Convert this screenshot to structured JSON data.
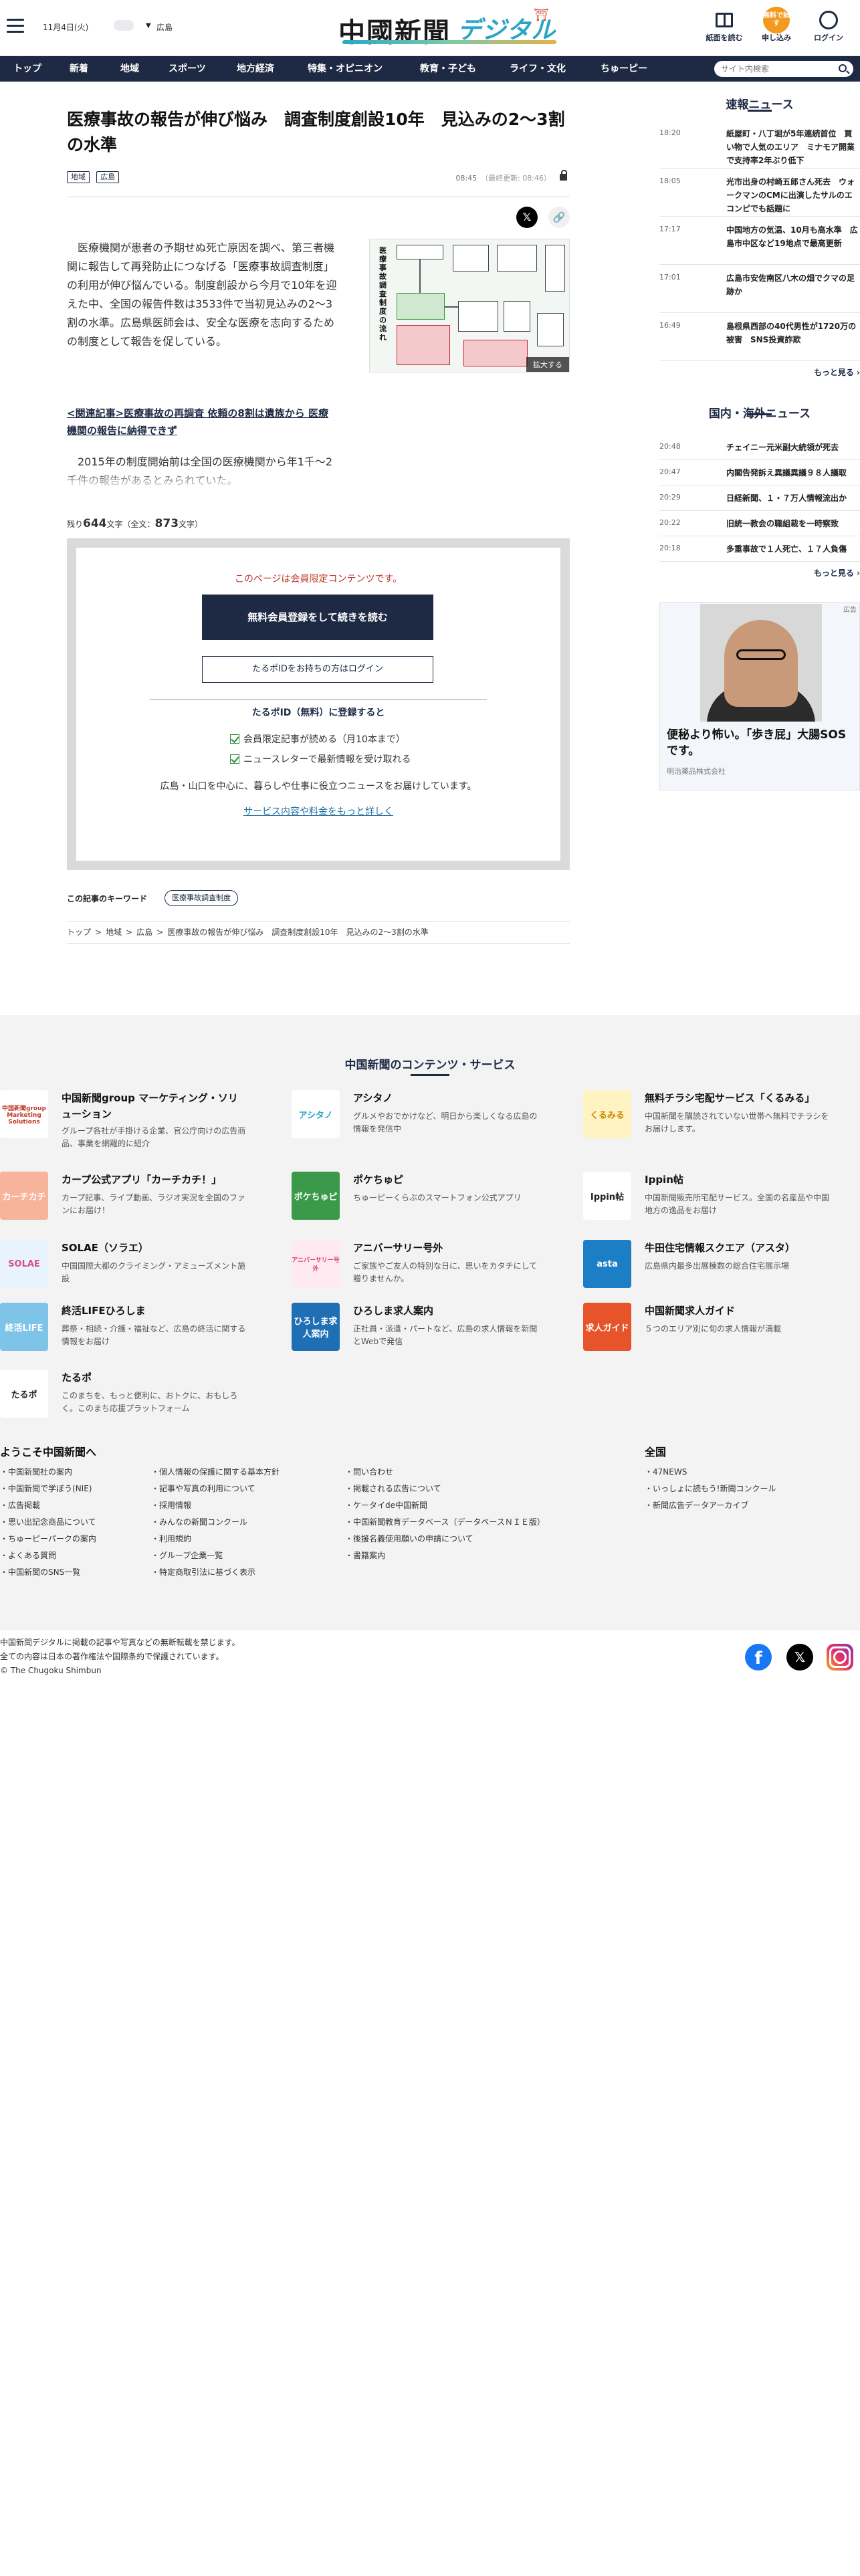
{
  "header": {
    "date": "11月4日(火)",
    "region": "広島",
    "region_arrow": "▼",
    "logo_main": "中國新聞",
    "logo_sub": "デジタル",
    "actions": [
      {
        "label": "紙面を読む",
        "icon": "newspaper-icon"
      },
      {
        "label": "申し込み",
        "icon": "trial-badge-icon",
        "badge": "無料で試す"
      },
      {
        "label": "ログイン",
        "icon": "login-icon"
      }
    ]
  },
  "nav": {
    "items": [
      "トップ",
      "新着",
      "地域",
      "スポーツ",
      "地方経済",
      "特集・オピニオン",
      "教育・子ども",
      "ライフ・文化",
      "ちゅーピー"
    ],
    "search_placeholder": "サイト内検索"
  },
  "article": {
    "title": "医療事故の報告が伸び悩み　調査制度創設10年　見込みの2～3割の水準",
    "tags": [
      "地域",
      "広島"
    ],
    "published": "08:45",
    "updated": "（最終更新: 08:46）",
    "lead": "医療機関が患者の予期せぬ死亡原因を調べ、第三者機関に報告して再発防止につなげる「医療事故調査制度」の利用が伸び悩んでいる。制度創設から今月で10年を迎えた中、全国の報告件数は3533件で当初見込みの2～3割の水準。広島県医師会は、安全な医療を志向するための制度として報告を促している。",
    "figure_title": "医療事故調査制度の流れ",
    "figure_enlarge": "拡大する",
    "related_link": "<関連記事>医療事故の再調査 依頼の8割は遺族から 医療機関の報告に納得できず",
    "para2": "2015年の制度開始前は全国の医療機関から年1千～2千件の報告があるとみられていた。",
    "remaining_prefix": "残り",
    "remaining_count": "644",
    "remaining_mid": "文字（全文：",
    "total_count": "873",
    "remaining_suffix": "文字）"
  },
  "paywall": {
    "note": "このページは会員限定コンテンツです。",
    "register_button": "無料会員登録をして続きを読む",
    "login_button": "たるポIDをお持ちの方はログイン",
    "free_heading": "たるポID（無料）に登録すると",
    "benefits": [
      "会員限定記事が読める（月10本まで）",
      "ニュースレターで最新情報を受け取れる"
    ],
    "region_text": "広島・山口を中心に、暮らしや仕事に役立つニュースをお届けしています。",
    "more_link": "サービス内容や料金をもっと詳しく"
  },
  "keywords": {
    "label": "この記事のキーワード",
    "items": [
      "医療事故調査制度"
    ]
  },
  "breadcrumb": [
    "トップ",
    ">",
    "地域",
    ">",
    "広島",
    ">",
    "医療事故の報告が伸び悩み　調査制度創設10年　見込みの2～3割の水準"
  ],
  "sidebar": {
    "breaking_head": "速報ニュース",
    "breaking": [
      {
        "time": "18:20",
        "text": "紙屋町・八丁堀が5年連続首位　買い物で人気のエリア　ミナモア開業で支持率2年ぶり低下"
      },
      {
        "time": "18:05",
        "text": "光市出身の村崎五郎さん死去　ウォークマンのCMに出演したサルのエコンピでも話題に"
      },
      {
        "time": "17:17",
        "text": "中国地方の気温、10月も高水準　広島市中区など19地点で最高更新"
      },
      {
        "time": "17:01",
        "text": "広島市安佐南区八木の畑でクマの足跡か"
      },
      {
        "time": "16:49",
        "text": "島根県西部の40代男性が1720万の被害　SNS投資詐欺"
      }
    ],
    "more": "もっと見る",
    "world_head": "国内・海外ニュース",
    "world": [
      {
        "time": "20:48",
        "text": "チェイニー元米副大統領が死去"
      },
      {
        "time": "20:47",
        "text": "内閣告発訴え異議異議９８人議取"
      },
      {
        "time": "20:29",
        "text": "日経新聞、１・７万人情報流出か"
      },
      {
        "time": "20:22",
        "text": "旧統一教会の職組裁を一時察致"
      },
      {
        "time": "20:18",
        "text": "多重事故で１人死亡、１７人負傷"
      }
    ],
    "ad_tag": "広告",
    "ad_title": "便秘より怖い。「歩き屁」大腸SOSです。",
    "ad_sponsor": "明治薬品株式会社"
  },
  "services": {
    "heading": "中国新聞のコンテンツ・サービス",
    "items": [
      {
        "title": "中国新聞group マーケティング・ソリューション",
        "desc": "グループ各社が手掛ける企業、官公庁向けの広告商品、事業を網羅的に紹介",
        "icon_text": "中国新聞group Marketing Solutions",
        "color": "#ffffff",
        "fg": "#c0392b"
      },
      {
        "title": "アシタノ",
        "desc": "グルメやおでかけなど、明日から楽しくなる広島の情報を発信中",
        "icon_text": "アシタノ",
        "color": "#ffffff",
        "fg": "#2aa6c4"
      },
      {
        "title": "無料チラシ宅配サービス「くるみる」",
        "desc": "中国新聞を購読されていない世帯へ無料でチラシをお届けします。",
        "icon_text": "くるみる",
        "color": "#fff3c4",
        "fg": "#c78a00"
      },
      {
        "title": "カープ公式アプリ「カーチカチ！」",
        "desc": "カープ記事、ライブ動画、ラジオ実況を全国のファンにお届け！",
        "icon_text": "カーチカチ",
        "color": "#f7b49a",
        "fg": "#ffffff"
      },
      {
        "title": "ポケちゅピ",
        "desc": "ちゅーピーくらぶのスマートフォン公式アプリ",
        "icon_text": "ポケちゅピ",
        "color": "#3a9a4a",
        "fg": "#ffffff"
      },
      {
        "title": "Ippin帖",
        "desc": "中国新聞販売所宅配サービス。全国の名産品や中国地方の逸品をお届け",
        "icon_text": "Ippin帖",
        "color": "#ffffff",
        "fg": "#222222"
      },
      {
        "title": "SOLAE（ソラエ）",
        "desc": "中国国際大都のクライミング・アミューズメント施設",
        "icon_text": "SOLAE",
        "color": "#e9f3fb",
        "fg": "#d64f8a"
      },
      {
        "title": "アニバーサリー号外",
        "desc": "ご家族やご友人の特別な日に、思いをカタチにして贈りませんか。",
        "icon_text": "アニバーサリー号外",
        "color": "#fde9ef",
        "fg": "#d84a7a"
      },
      {
        "title": "牛田住宅情報スクエア（アスタ）",
        "desc": "広島県内最多出展棟数の総合住宅展示場",
        "icon_text": "asta",
        "color": "#1c7ec4",
        "fg": "#ffffff"
      },
      {
        "title": "終活LIFEひろしま",
        "desc": "葬祭・相続・介護・福祉など、広島の終活に関する情報をお届け",
        "icon_text": "終活LIFE",
        "color": "#7ec3e8",
        "fg": "#ffffff"
      },
      {
        "title": "ひろしま求人案内",
        "desc": "正社員・派遣・パートなど、広島の求人情報を新聞とWebで発信",
        "icon_text": "ひろしま求人案内",
        "color": "#1f6fb5",
        "fg": "#ffffff"
      },
      {
        "title": "中国新聞求人ガイド",
        "desc": "５つのエリア別に旬の求人情報が満載",
        "icon_text": "求人ガイド",
        "color": "#e8542a",
        "fg": "#ffffff"
      },
      {
        "title": "たるポ",
        "desc": "このまちを、もっと便利に、おトクに、おもしろく。このまち応援プラットフォーム",
        "icon_text": "たるポ",
        "color": "#ffffff",
        "fg": "#222222"
      }
    ]
  },
  "footer": {
    "welcome_head": "ようこそ中国新聞へ",
    "col1": [
      "中国新聞社の案内",
      "中国新聞で学ぼう(NIE)",
      "広告掲載",
      "思い出記念商品について",
      "ちゅーピーパークの案内",
      "よくある質問",
      "中国新聞のSNS一覧"
    ],
    "col2": [
      "個人情報の保護に関する基本方針",
      "記事や写真の利用について",
      "採用情報",
      "みんなの新聞コンクール",
      "利用規約",
      "グループ企業一覧",
      "特定商取引法に基づく表示"
    ],
    "col3": [
      "問い合わせ",
      "掲載される広告について",
      "ケータイde中国新聞",
      "中国新聞教育データベース（データベースＮＩＥ版）",
      "後援名義使用願いの申請について",
      "書籍案内"
    ],
    "national_head": "全国",
    "col4": [
      "47NEWS",
      "いっしょに読もう!新聞コンクール",
      "新聞広告データアーカイブ"
    ],
    "copyright": [
      "中国新聞デジタルに掲載の記事や写真などの無断転載を禁じます。",
      "全ての内容は日本の著作権法や国際条約で保護されています。",
      "© The Chugoku Shimbun"
    ]
  }
}
